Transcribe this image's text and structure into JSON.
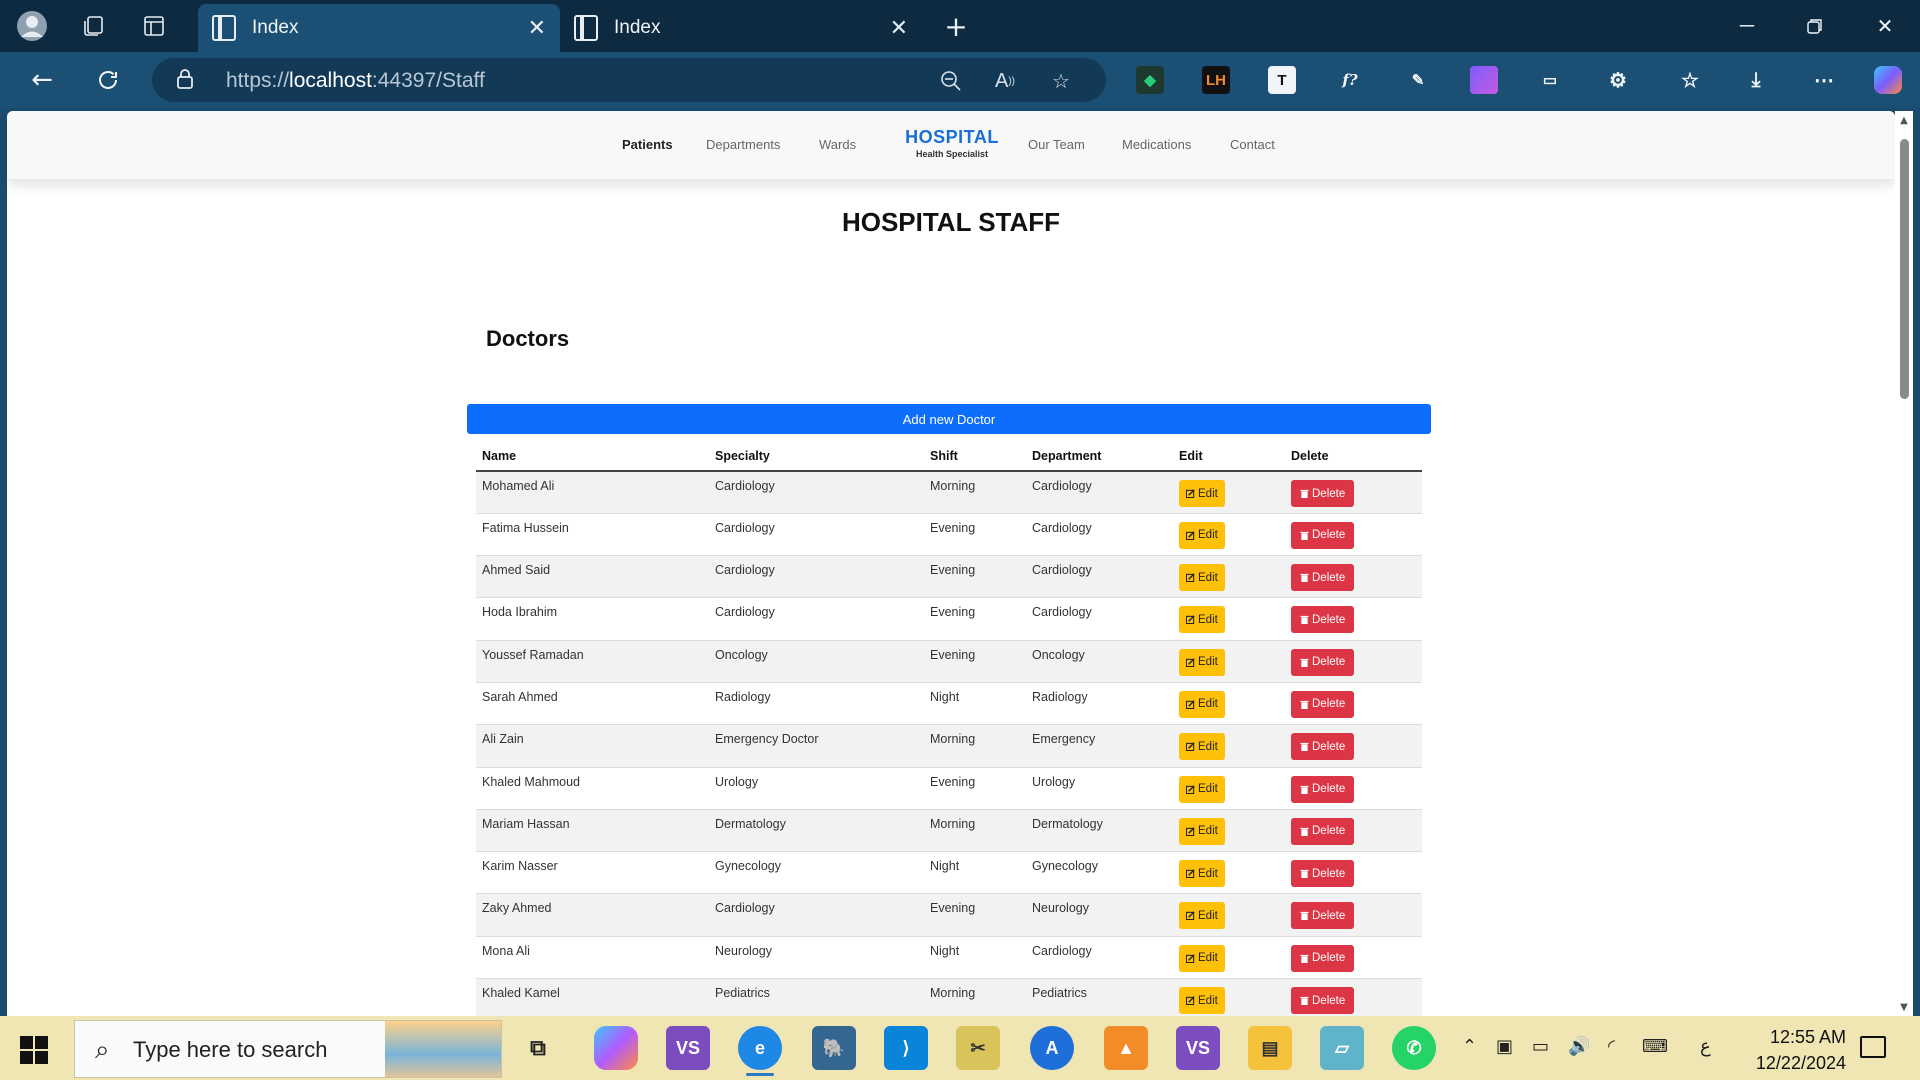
{
  "browser": {
    "tabs": [
      {
        "title": "Index",
        "active": true
      },
      {
        "title": "Index",
        "active": false
      }
    ],
    "url_prefix": "https://",
    "url_host": "localhost",
    "url_rest": ":44397/Staff"
  },
  "site": {
    "nav_left": [
      "Patients",
      "Departments",
      "Wards"
    ],
    "nav_right": [
      "Our Team",
      "Medications",
      "Contact"
    ],
    "brand_title": "HOSPITAL",
    "brand_subtitle": "Health Specialist"
  },
  "page": {
    "title": "HOSPITAL STAFF",
    "section_title": "Doctors",
    "add_button": "Add new Doctor"
  },
  "table": {
    "headers": [
      "Name",
      "Specialty",
      "Shift",
      "Department",
      "Edit",
      "Delete"
    ],
    "edit_label": "Edit",
    "delete_label": "Delete",
    "rows": [
      [
        "Mohamed Ali",
        "Cardiology",
        "Morning",
        "Cardiology"
      ],
      [
        "Fatima Hussein",
        "Cardiology",
        "Evening",
        "Cardiology"
      ],
      [
        "Ahmed Said",
        "Cardiology",
        "Evening",
        "Cardiology"
      ],
      [
        "Hoda Ibrahim",
        "Cardiology",
        "Evening",
        "Cardiology"
      ],
      [
        "Youssef Ramadan",
        "Oncology",
        "Evening",
        "Oncology"
      ],
      [
        "Sarah Ahmed",
        "Radiology",
        "Night",
        "Radiology"
      ],
      [
        "Ali Zain",
        "Emergency Doctor",
        "Morning",
        "Emergency"
      ],
      [
        "Khaled Mahmoud",
        "Urology",
        "Evening",
        "Urology"
      ],
      [
        "Mariam Hassan",
        "Dermatology",
        "Morning",
        "Dermatology"
      ],
      [
        "Karim Nasser",
        "Gynecology",
        "Night",
        "Gynecology"
      ],
      [
        "Zaky Ahmed",
        "Cardiology",
        "Evening",
        "Neurology"
      ],
      [
        "Mona Ali",
        "Neurology",
        "Night",
        "Cardiology"
      ],
      [
        "Khaled Kamel",
        "Pediatrics",
        "Morning",
        "Pediatrics"
      ]
    ]
  },
  "taskbar": {
    "search_placeholder": "Type here to search",
    "time": "12:55 AM",
    "date": "12/22/2024",
    "lang": "ع"
  },
  "colors": {
    "primary": "#0d6efd",
    "warning": "#ffc107",
    "danger": "#dc3545",
    "brand": "#1a6fd6"
  }
}
